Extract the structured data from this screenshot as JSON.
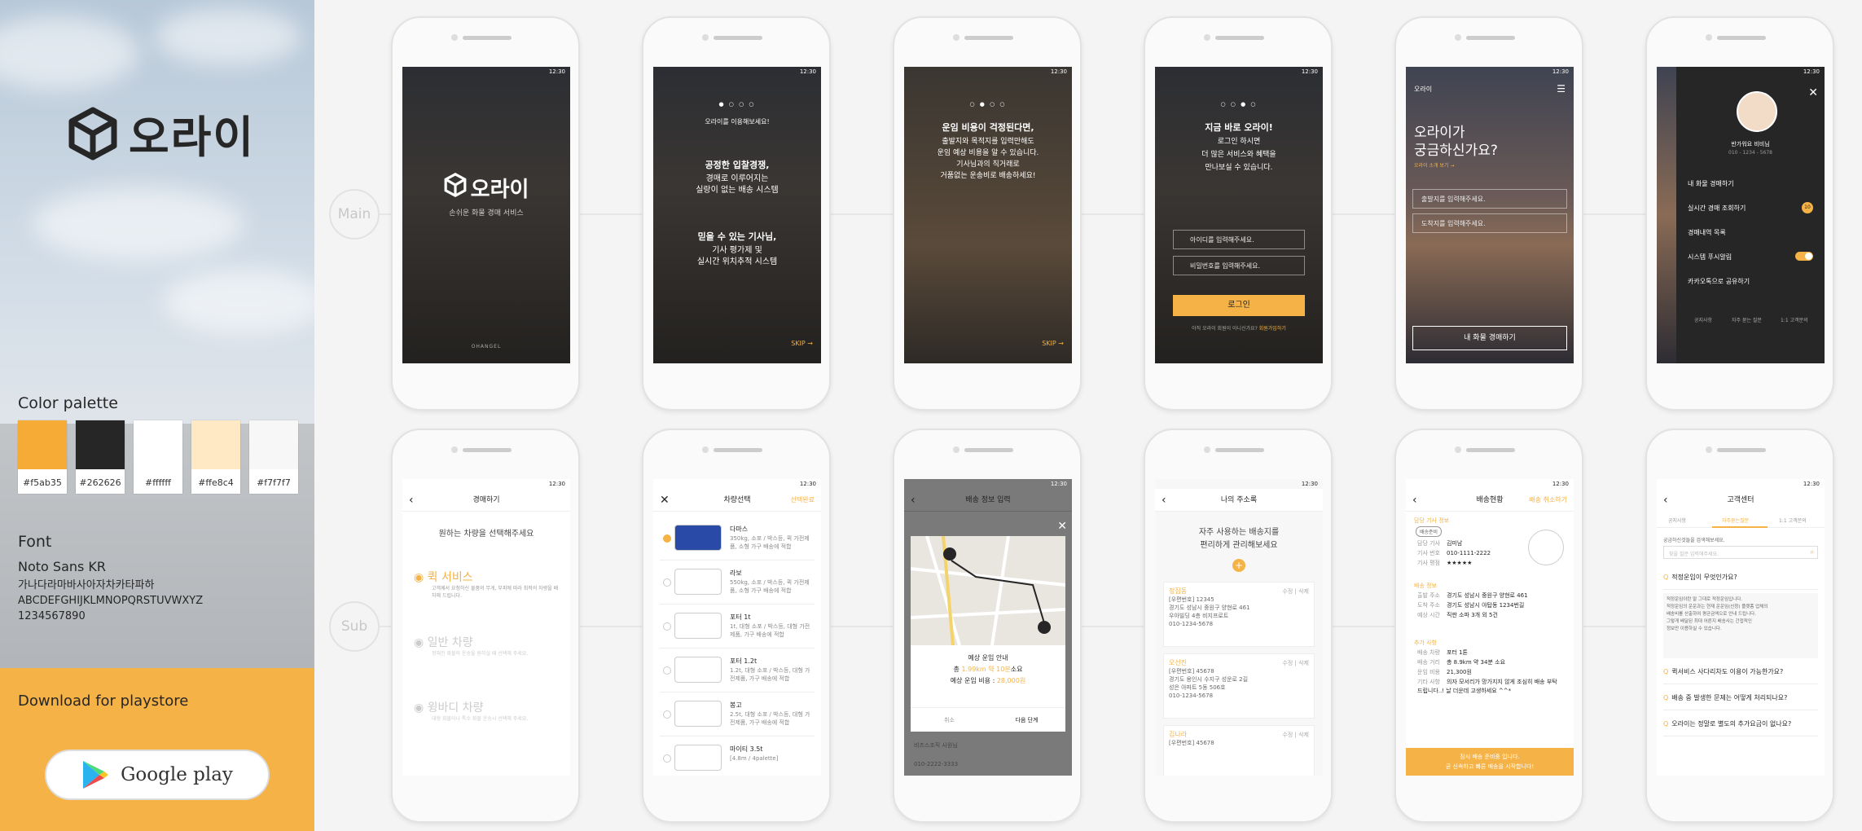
{
  "brand": {
    "name": "오라이"
  },
  "palette": {
    "title": "Color palette",
    "colors": [
      {
        "hex": "#f5ab35",
        "label": "#f5ab35"
      },
      {
        "hex": "#262626",
        "label": "#262626"
      },
      {
        "hex": "#ffffff",
        "label": "#ffffff"
      },
      {
        "hex": "#ffe8c4",
        "label": "#ffe8c4"
      },
      {
        "hex": "#f7f7f7",
        "label": "#f7f7f7"
      }
    ]
  },
  "font": {
    "title": "Font",
    "name": "Noto Sans KR",
    "sample_hangul": "가나다라마바사아자차카타파하",
    "sample_latin": "ABCDEFGHIJKLMNOPQRSTUVWXYZ",
    "sample_digits": "1234567890"
  },
  "download": {
    "label": "Download for playstore",
    "store": "Google play"
  },
  "flows": {
    "main": "Main",
    "sub": "Sub"
  },
  "status_time": "12:30",
  "screens": {
    "splash": {
      "brand": "오라이",
      "tagline": "손쉬운 화물 경매 서비스",
      "footer": "OHANGEL"
    },
    "intro1": {
      "header": "오라이를 이용해보세요!",
      "headline": "공정한 입찰경쟁,",
      "sub": [
        "경매로 이루어지는",
        "실랑이 없는 배송 시스템"
      ],
      "headline2": "믿을 수 있는 기사님,",
      "sub2": [
        "기사 평가제 및",
        "실시간 위치추적 시스템"
      ],
      "skip": "SKIP"
    },
    "intro2": {
      "headline": "운임 비용이 걱정된다면,",
      "lines": [
        "출발지와 목적지를 입력만해도",
        "운임 예상 비용을 알 수 있습니다.",
        "기사님과의 직거래로",
        "거품없는 운송비로 배송하세요!"
      ],
      "skip": "SKIP"
    },
    "login": {
      "headline": "지금 바로 오라이!",
      "lines": [
        "로그인 하시면",
        "더 많은 서비스와 혜택을",
        "만나보실 수 있습니다."
      ],
      "id_placeholder": "아이디를 입력해주세요.",
      "pw_placeholder": "비밀번호를 입력해주세요.",
      "login_button": "로그인",
      "signup_prompt": "아직 오라이 회원이 아니신가요?",
      "signup_link": "회원가입하기"
    },
    "home": {
      "logo": "오라이",
      "headline": [
        "오라이가",
        "궁금하신가요?"
      ],
      "about_link": "오라이 소개 보기 →",
      "origin_placeholder": "출발지를 입력해주세요.",
      "dest_placeholder": "도착지를 입력해주세요.",
      "cta": "내 화물 경매하기"
    },
    "menu": {
      "greeting": "반가워요 비비님",
      "phone": "010 - 1234 - 5678",
      "items": [
        "내 화물 경매하기",
        "실시간 경매 조회하기",
        "경매내역 목록",
        "시스템 푸시알림",
        "카카오톡으로 공유하기"
      ],
      "badge": "10",
      "footer": [
        "공지사항",
        "자주 묻는 질문",
        "1:1 고객문의"
      ]
    },
    "auction": {
      "title": "경매하기",
      "prompt": "원하는 차량을 선택해주세요",
      "options": [
        {
          "name": "퀵 서비스",
          "desc": "고객께서 요청하신 물품의 무게, 부피에 따라 최적의 차량을 배차해 드립니다."
        },
        {
          "name": "일반 차량",
          "desc": "정해진 화물의 운송을 원하실 때 선택해 주세요."
        },
        {
          "name": "윙바디 차량",
          "desc": "대형 화물이나 특수 화물 운송시 선택해 주세요."
        }
      ]
    },
    "vehicle": {
      "title": "차량선택",
      "action": "선택완료",
      "items": [
        {
          "name": "다마스",
          "desc": "350kg, 소포 / 박스등, 퀵 가전제품, 소형 가구 배송에 적합"
        },
        {
          "name": "라보",
          "desc": "550kg, 소포 / 박스등, 퀵 가전제품, 소형 가구 배송에 적합"
        },
        {
          "name": "포터 1t",
          "desc": "1t, 대형 소포 / 박스등, 대형 가전제품, 가구 배송에 적합"
        },
        {
          "name": "포터 1.2t",
          "desc": "1.2t, 대형 소포 / 박스등, 대형 가전제품, 가구 배송에 적합"
        },
        {
          "name": "봉고",
          "desc": "2.5t, 대형 소포 / 박스등, 대형 가전제품, 가구 배송에 적합"
        },
        {
          "name": "마이티 3.5t",
          "desc": "[4.8m / 4palette]"
        }
      ]
    },
    "quote": {
      "title": "배송 정보 입력",
      "heading": "예상 운임 안내",
      "distance_prefix": "총",
      "distance": "1.99km",
      "duration": "약 10분",
      "duration_suffix": "소요",
      "price_label": "예상 운임 비용 :",
      "price": "28,000원",
      "cancel": "취소",
      "next": "다음 단계",
      "under1": "비즈스조직 사원님",
      "under2": "010-2222-3333"
    },
    "addresses": {
      "title": "나의 주소록",
      "prompt": [
        "자주 사용하는 배송지를",
        "편리하게 관리해보세요"
      ],
      "entries": [
        {
          "name": "정집동",
          "action": "수정 | 삭제",
          "lines": [
            "[우편번호] 12345",
            "경기도 성남시 중원구 양현로 461",
            "우아빌딩 4층 비지프로트",
            "010-1234-5678"
          ]
        },
        {
          "name": "오선진",
          "action": "수정 | 삭제",
          "lines": [
            "[우편번호] 45678",
            "경기도 용인시 수지구 성운로 2길",
            "성은 아파트 5동 506호",
            "010-1234-5678"
          ]
        },
        {
          "name": "김나라",
          "action": "수정 | 삭제",
          "lines": [
            "[우편번호] 45678"
          ]
        }
      ]
    },
    "delivery": {
      "title": "배송현황",
      "action": "배송 취소하기",
      "driver_section": "담당 기사 정보",
      "status_badge": "배송준비",
      "driver_rows": [
        [
          "담당 기사",
          "김미남"
        ],
        [
          "기사 번호",
          "010-1111-2222"
        ],
        [
          "기사 평점",
          "★★★★★"
        ]
      ],
      "info_section": "배송 정보",
      "info_rows": [
        [
          "출발 주소",
          "경기도 성남시 중원구 양현로 461"
        ],
        [
          "도착 주소",
          "경기도 성남시 야탑동 1234번길"
        ],
        [
          "예상 시간",
          "직판 소파 3개 외 5건"
        ]
      ],
      "extra_section": "추가 사항",
      "extra_rows": [
        [
          "배송 차량",
          "포터 1톤"
        ],
        [
          "배송 거리",
          "총 8.9km 약 34분 소요"
        ],
        [
          "운임 비용",
          "21,300원"
        ],
        [
          "기타 사항",
          "의자 모서리가 망가지지 않게 조심히 배송 부탁 드립니다..! 날 더운데 고생하세요 ^^*"
        ]
      ],
      "banner": [
        "잠시 배송 준비중 입니다.",
        "곧 신속하고 빠른 배송을 시작합니다!"
      ]
    },
    "support": {
      "title": "고객센터",
      "tabs": [
        "공지사항",
        "자주묻는질문",
        "1:1 고객문의"
      ],
      "prompt": "궁금하신것들을 검색해보세요.",
      "search_placeholder": "찾을 질문 입력해주세요.",
      "faqs": [
        "적정운임이 무엇인가요?",
        "퀵서비스 사다리차도 이용이 가능한가요?",
        "배송 중 발생한 문제는 어떻게 처리되나요?",
        "오라이는 정말로 별도의 추가요금이 없나요?"
      ],
      "answer": [
        "적정운임이란 말 그대로 적정운임입니다.",
        "적정운임의 운운과는 현재 운운임(신청) 플랫폼 업체의",
        "배송비를 산출하여 평균금액으로 안내 드립니다.",
        "그렇게 배달된 최대 어른지 배송사는 간접적인",
        "정보만 이용하실 수 있습니다."
      ]
    }
  }
}
